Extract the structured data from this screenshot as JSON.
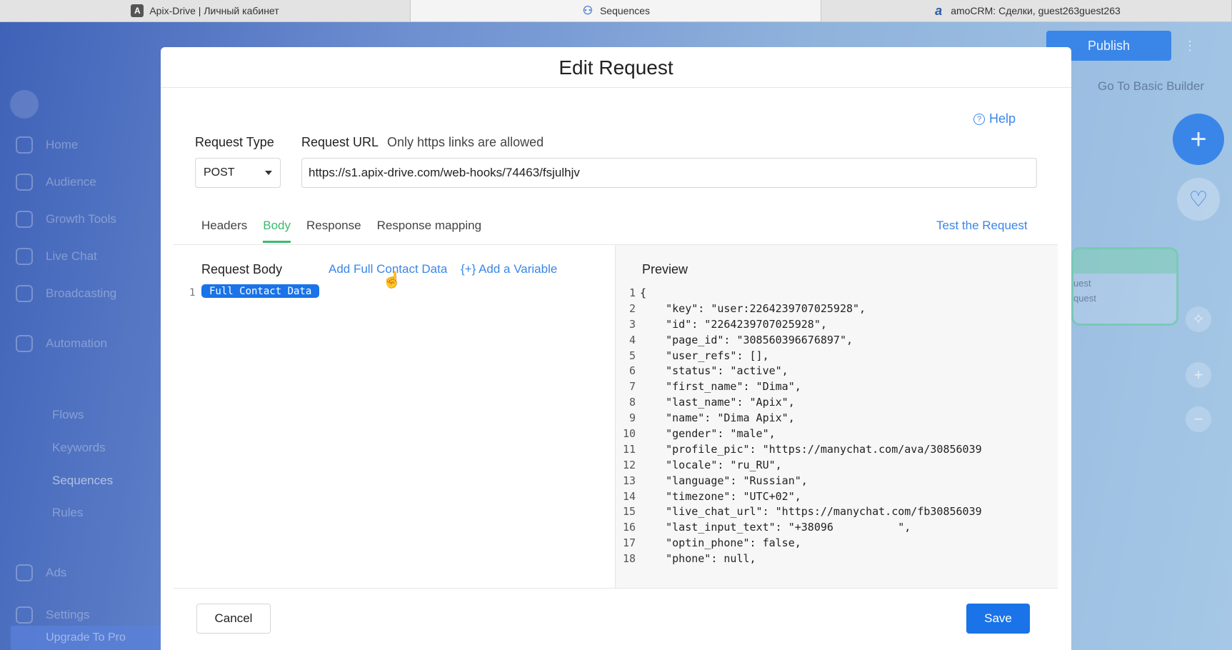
{
  "browser": {
    "tabs": [
      {
        "label": "Apix-Drive | Личный кабинет",
        "icon": "A"
      },
      {
        "label": "Sequences",
        "icon": "sequences-icon"
      },
      {
        "label": "amoCRM: Сделки, guest263guest263",
        "icon": "a"
      }
    ]
  },
  "background": {
    "sidebar": {
      "items": [
        "Home",
        "Audience",
        "Growth Tools",
        "Live Chat",
        "Broadcasting",
        "Automation"
      ],
      "sub_items": [
        "Flows",
        "Keywords",
        "Sequences",
        "Rules"
      ],
      "bottom_items": [
        "Ads",
        "Settings"
      ],
      "upgrade_label": "Upgrade To Pro"
    },
    "publish_label": "Publish",
    "basic_builder_label": "Go To Basic Builder",
    "node_lines": [
      "uest",
      "quest"
    ]
  },
  "modal": {
    "title": "Edit Request",
    "help_label": "Help",
    "request_type_label": "Request Type",
    "request_url_label": "Request URL",
    "request_url_hint": "Only https links are allowed",
    "request_type_value": "POST",
    "request_url_value": "https://s1.apix-drive.com/web-hooks/74463/fsjulhjv",
    "tabs": [
      "Headers",
      "Body",
      "Response",
      "Response mapping"
    ],
    "active_tab": "Body",
    "test_label": "Test the Request",
    "body": {
      "title": "Request Body",
      "add_full_label": "Add Full Contact Data",
      "add_variable_label": "{+} Add a Variable",
      "line_number": "1",
      "chip_label": "Full Contact Data"
    },
    "preview": {
      "title": "Preview",
      "lines": [
        "{",
        "    \"key\": \"user:2264239707025928\",",
        "    \"id\": \"2264239707025928\",",
        "    \"page_id\": \"308560396676897\",",
        "    \"user_refs\": [],",
        "    \"status\": \"active\",",
        "    \"first_name\": \"Dima\",",
        "    \"last_name\": \"Apix\",",
        "    \"name\": \"Dima Apix\",",
        "    \"gender\": \"male\",",
        "    \"profile_pic\": \"https://manychat.com/ava/30856039",
        "    \"locale\": \"ru_RU\",",
        "    \"language\": \"Russian\",",
        "    \"timezone\": \"UTC+02\",",
        "    \"live_chat_url\": \"https://manychat.com/fb30856039",
        "    \"last_input_text\": \"+38096          \",",
        "    \"optin_phone\": false,",
        "    \"phone\": null,"
      ]
    },
    "cancel_label": "Cancel",
    "save_label": "Save"
  },
  "colors": {
    "accent": "#1a73e8",
    "link": "#3a86e8",
    "active_tab": "#3cba6e"
  }
}
